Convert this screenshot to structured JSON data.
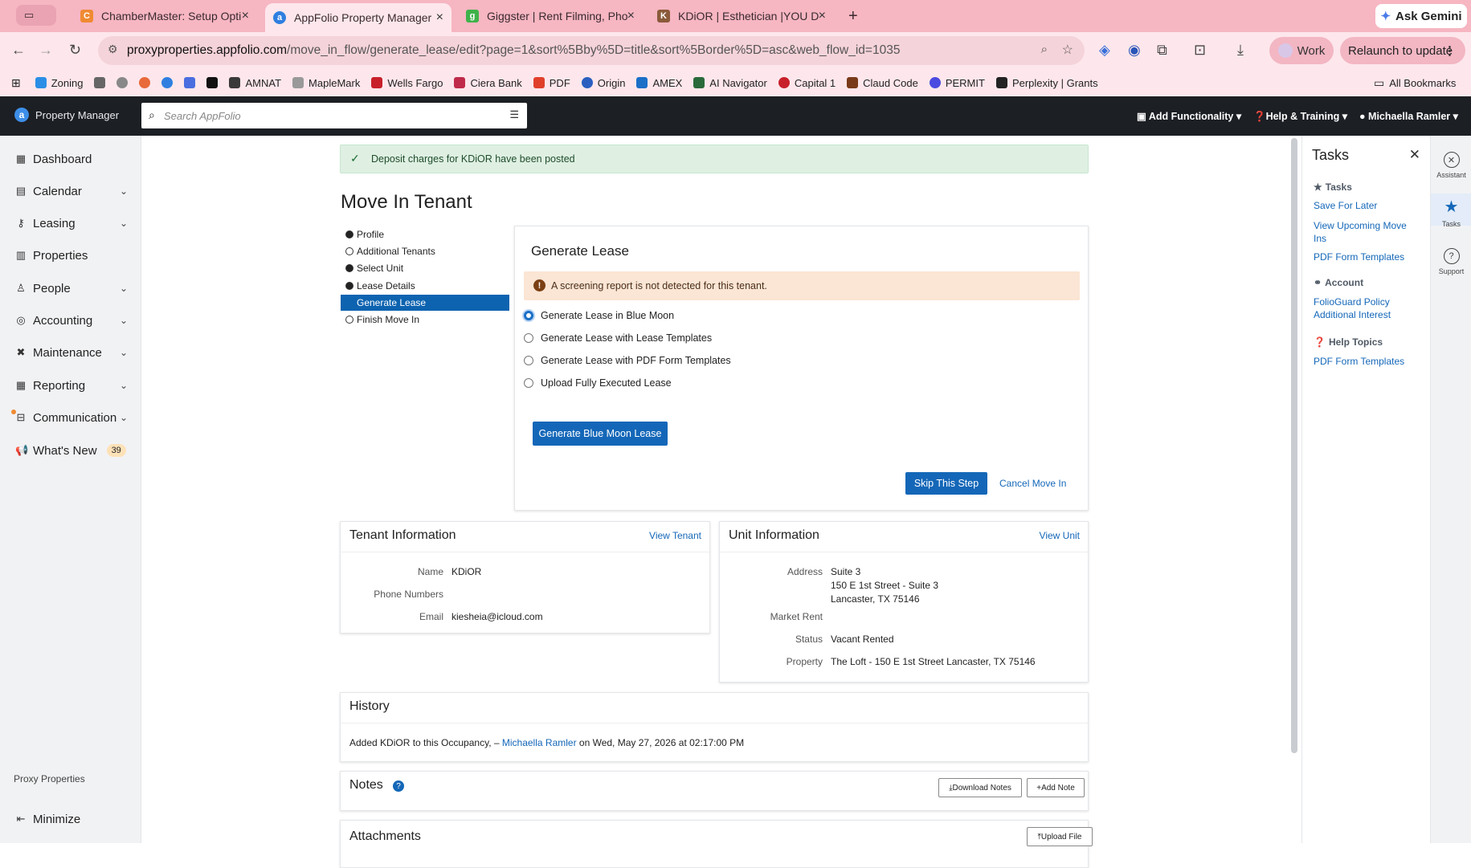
{
  "browser": {
    "tabs": [
      {
        "title": "ChamberMaster: Setup Optio",
        "active": false,
        "icon": "chambermaster-icon"
      },
      {
        "title": "AppFolio Property Manager",
        "active": true,
        "icon": "appfolio-icon"
      },
      {
        "title": "Giggster | Rent Filming, Photo",
        "active": false,
        "icon": "giggster-icon"
      },
      {
        "title": "KDiOR | Esthetician |YOU DEF",
        "active": false,
        "icon": "kdior-icon"
      }
    ],
    "ask_gemini": "Ask Gemini",
    "url_host": "proxyproperties.appfolio.com",
    "url_path": "/move_in_flow/generate_lease/edit?page=1&sort%5Bby%5D=title&sort%5Border%5D=asc&web_flow_id=1035",
    "profile_label": "Work",
    "relaunch_label": "Relaunch to update",
    "bookmarks": [
      "Zoning",
      "AMNAT",
      "MapleMark",
      "Wells Fargo",
      "Ciera Bank",
      "PDF",
      "Origin",
      "AMEX",
      "AI Navigator",
      "Capital 1",
      "Claud Code",
      "PERMIT",
      "Perplexity | Grants"
    ],
    "all_bookmarks": "All Bookmarks"
  },
  "app": {
    "brand": "Property Manager",
    "search_placeholder": "Search AppFolio",
    "header_menus": {
      "add_functionality": "Add Functionality",
      "help_training": "Help & Training",
      "user": "Michaella Ramler"
    }
  },
  "nav": {
    "items": [
      {
        "label": "Dashboard",
        "icon": "dashboard-icon",
        "has_chevron": false
      },
      {
        "label": "Calendar",
        "icon": "calendar-icon",
        "has_chevron": true
      },
      {
        "label": "Leasing",
        "icon": "key-icon",
        "has_chevron": true
      },
      {
        "label": "Properties",
        "icon": "building-icon",
        "has_chevron": false
      },
      {
        "label": "People",
        "icon": "person-icon",
        "has_chevron": true
      },
      {
        "label": "Accounting",
        "icon": "accounting-icon",
        "has_chevron": true
      },
      {
        "label": "Maintenance",
        "icon": "tools-icon",
        "has_chevron": true
      },
      {
        "label": "Reporting",
        "icon": "table-icon",
        "has_chevron": true
      },
      {
        "label": "Communication",
        "icon": "inbox-icon",
        "has_chevron": true
      },
      {
        "label": "What's New",
        "icon": "megaphone-icon",
        "has_chevron": false,
        "badge": "39"
      }
    ],
    "company": "Proxy Properties",
    "minimize": "Minimize"
  },
  "alert": {
    "text": "Deposit charges for KDiOR have been posted"
  },
  "page_title": "Move In Tenant",
  "steps": [
    {
      "label": "Profile",
      "state": "done"
    },
    {
      "label": "Additional Tenants",
      "state": "todo"
    },
    {
      "label": "Select Unit",
      "state": "done"
    },
    {
      "label": "Lease Details",
      "state": "done"
    },
    {
      "label": "Generate Lease",
      "state": "active"
    },
    {
      "label": "Finish Move In",
      "state": "todo"
    }
  ],
  "generate_lease": {
    "title": "Generate Lease",
    "warning": "A screening report is not detected for this tenant.",
    "options": [
      {
        "label": "Generate Lease in Blue Moon",
        "selected": true
      },
      {
        "label": "Generate Lease with Lease Templates",
        "selected": false
      },
      {
        "label": "Generate Lease with PDF Form Templates",
        "selected": false
      },
      {
        "label": "Upload Fully Executed Lease",
        "selected": false
      }
    ],
    "action_button": "Generate Blue Moon Lease",
    "skip_button": "Skip This Step",
    "cancel_link": "Cancel Move In"
  },
  "tenant_info": {
    "title": "Tenant Information",
    "link": "View Tenant",
    "rows": [
      {
        "label": "Name",
        "value": "KDiOR"
      },
      {
        "label": "Phone Numbers",
        "value": ""
      },
      {
        "label": "Email",
        "value": "kiesheia@icloud.com"
      }
    ]
  },
  "unit_info": {
    "title": "Unit Information",
    "link": "View Unit",
    "address_label": "Address",
    "address_lines": [
      "Suite 3",
      "150 E 1st Street - Suite 3",
      "Lancaster, TX 75146"
    ],
    "market_rent_label": "Market Rent",
    "market_rent": "",
    "status_label": "Status",
    "status": "Vacant Rented",
    "property_label": "Property",
    "property": "The Loft - 150 E 1st Street Lancaster, TX 75146"
  },
  "history": {
    "title": "History",
    "entry_prefix": "Added KDiOR to this Occupancy, – ",
    "entry_user": "Michaella Ramler",
    "entry_suffix": " on Wed, May 27, 2026 at 02:17:00 PM"
  },
  "notes": {
    "title": "Notes",
    "download": "Download Notes",
    "add": "Add Note"
  },
  "attachments": {
    "title": "Attachments",
    "upload": "Upload File"
  },
  "tasks_panel": {
    "title": "Tasks",
    "sections": [
      {
        "heading": "Tasks",
        "icon": "star-icon",
        "links": [
          "Save For Later",
          "View Upcoming Move Ins",
          "PDF Form Templates"
        ]
      },
      {
        "heading": "Account",
        "icon": "account-icon",
        "links": [
          "FolioGuard Policy Additional Interest"
        ]
      },
      {
        "heading": "Help Topics",
        "icon": "help-icon",
        "links": [
          "PDF Form Templates"
        ]
      }
    ]
  },
  "rail": [
    {
      "label": "Assistant",
      "icon": "assistant-icon"
    },
    {
      "label": "Tasks",
      "icon": "star-icon"
    },
    {
      "label": "Support",
      "icon": "support-icon"
    }
  ],
  "colors": {
    "brand_blue": "#1467b8",
    "header_bg": "#1c1f24",
    "tab_strip": "#f6b6c2",
    "success_bg": "#dff0e3",
    "warning_bg": "#fbe5d4"
  }
}
